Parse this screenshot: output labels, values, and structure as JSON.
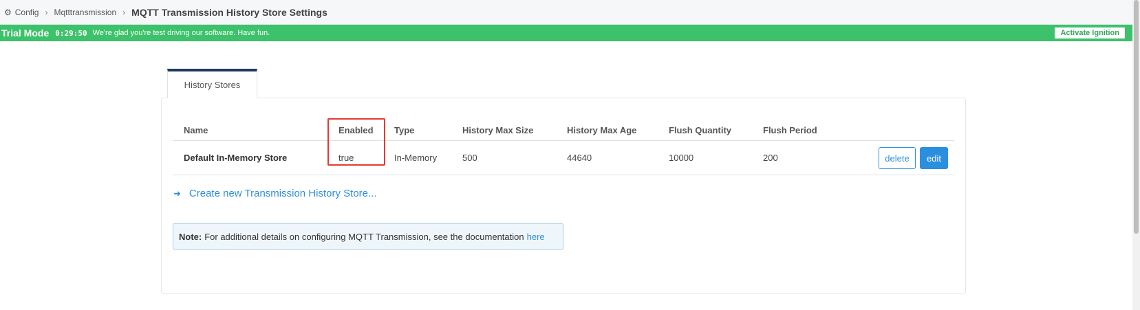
{
  "breadcrumb": {
    "items": [
      {
        "label": "Config",
        "icon": "gear-icon"
      },
      {
        "label": "Mqtttransmission"
      }
    ],
    "separator": "›",
    "current": "MQTT Transmission History Store Settings"
  },
  "trial_banner": {
    "title": "Trial Mode",
    "timer": "0:29:50",
    "message": "We're glad you're test driving our software. Have fun.",
    "activate_label": "Activate Ignition",
    "color": "#3cc26a"
  },
  "tab": {
    "label": "History Stores"
  },
  "table": {
    "headers": {
      "name": "Name",
      "enabled": "Enabled",
      "type": "Type",
      "max_size": "History Max Size",
      "max_age": "History Max Age",
      "flush_quantity": "Flush Quantity",
      "flush_period": "Flush Period"
    },
    "rows": [
      {
        "name": "Default In-Memory Store",
        "enabled": "true",
        "type": "In-Memory",
        "max_size": "500",
        "max_age": "44640",
        "flush_quantity": "10000",
        "flush_period": "200",
        "delete_label": "delete",
        "edit_label": "edit"
      }
    ]
  },
  "create_link": {
    "icon": "arrow-right-icon",
    "label": "Create new Transmission History Store..."
  },
  "note": {
    "label": "Note:",
    "text": "For additional details on configuring MQTT Transmission, see the documentation",
    "link_label": "here"
  },
  "colors": {
    "accent": "#2e8fd6",
    "highlight": "#e53935"
  }
}
